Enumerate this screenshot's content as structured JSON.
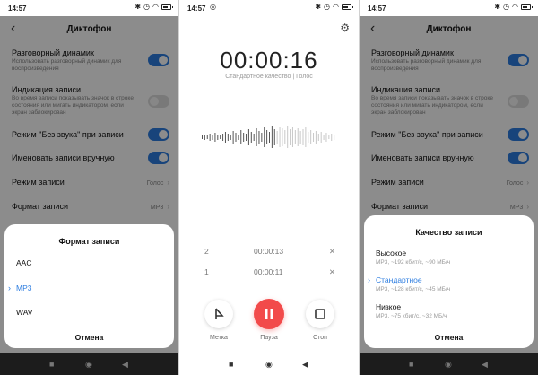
{
  "left": {
    "status": {
      "time": "14:57"
    },
    "header": {
      "title": "Диктофон"
    },
    "settings": {
      "speaker": {
        "label": "Разговорный динамик",
        "sub": "Использовать разговорный динамик для воспроизведения",
        "on": true
      },
      "indicator": {
        "label": "Индикация записи",
        "sub": "Во время записи показывать значок в строке состояния или мигать индикатором, если экран заблокирован",
        "on": false
      },
      "silent": {
        "label": "Режим \"Без звука\" при записи",
        "on": true
      },
      "naming": {
        "label": "Именовать записи вручную",
        "on": true
      },
      "mode": {
        "label": "Режим записи",
        "value": "Голос"
      },
      "format": {
        "label": "Формат записи",
        "value": "MP3"
      }
    },
    "sheet": {
      "title": "Формат записи",
      "options": [
        "AAC",
        "MP3",
        "WAV"
      ],
      "selected": "MP3",
      "cancel": "Отмена"
    }
  },
  "recorder": {
    "status": {
      "time": "14:57"
    },
    "timer": "00:00:16",
    "quality": "Стандартное качество | Голос",
    "marks": [
      {
        "num": "2",
        "time": "00:00:13"
      },
      {
        "num": "1",
        "time": "00:00:11"
      }
    ],
    "controls": {
      "mark": "Метка",
      "pause": "Пауза",
      "stop": "Стоп"
    },
    "accent": "#f24a4a"
  },
  "right": {
    "status": {
      "time": "14:57"
    },
    "sheet": {
      "title": "Качество записи",
      "options": [
        {
          "label": "Высокое",
          "sub": "MP3, ~192 кбит/с, ~90 МБ/ч"
        },
        {
          "label": "Стандартное",
          "sub": "MP3, ~128 кбит/с, ~45 МБ/ч"
        },
        {
          "label": "Низкое",
          "sub": "MP3, ~75 кбит/с, ~32 МБ/ч"
        }
      ],
      "selected": "Стандартное",
      "cancel": "Отмена"
    }
  },
  "accent_blue": "#2d7de0"
}
